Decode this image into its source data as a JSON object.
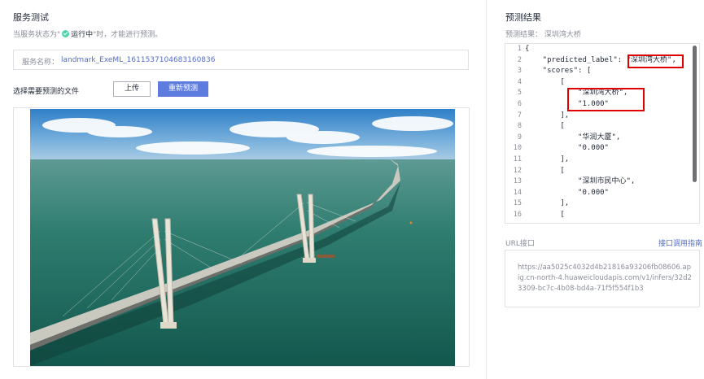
{
  "left": {
    "title": "服务测试",
    "status_prefix": "当服务状态为\"",
    "status_running": "运行中",
    "status_suffix": "\"时，才能进行预测。",
    "service_label": "服务名称：",
    "service_name": "landmark_ExeML_1611537104683160836",
    "file_label": "选择需要预测的文件",
    "upload_button": "上传",
    "repredict_button": "重新预测"
  },
  "right": {
    "title": "预测结果",
    "result_label": "预测结果：",
    "result_value": "深圳湾大桥",
    "code": {
      "line_numbers": [
        "1",
        "2",
        "3",
        "4",
        "5",
        "6",
        "7",
        "8",
        "9",
        "10",
        "11",
        "12",
        "13",
        "14",
        "15",
        "16"
      ],
      "lines": [
        "{",
        "    \"predicted_label\": \"深圳湾大桥\",",
        "    \"scores\": [",
        "        [",
        "            \"深圳湾大桥\",",
        "            \"1.000\"",
        "        ],",
        "        [",
        "            \"华润大厦\",",
        "            \"0.000\"",
        "        ],",
        "        [",
        "            \"深圳市民中心\",",
        "            \"0.000\"",
        "        ],",
        "        ["
      ]
    },
    "url_label": "URL接口",
    "url_guide": "接口调用指南",
    "url_value": "https://aa5025c4032d4b21816a93206fb08606.apig.cn-north-4.huaweicloudapis.com/v1/infers/32d23309-bc7c-4b08-bd4a-71f5f554f1b3"
  },
  "colors": {
    "primary": "#5e7ce0",
    "link": "#526ecc",
    "success": "#50d4ab",
    "highlight": "#e00000"
  }
}
